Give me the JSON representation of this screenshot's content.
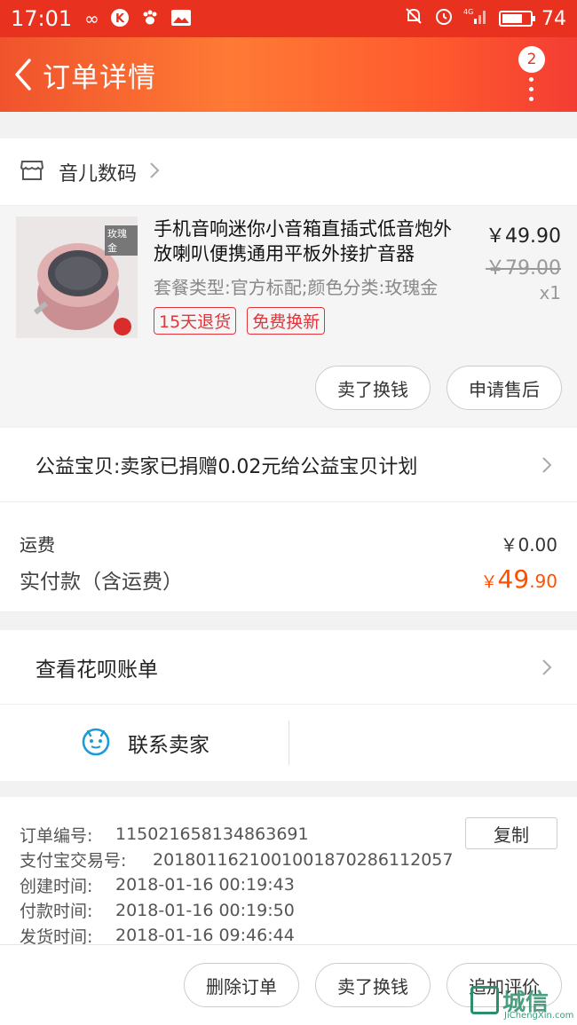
{
  "status_bar": {
    "time": "17:01",
    "network": "4G",
    "battery": "74",
    "battery_level": 0.74
  },
  "nav": {
    "title": "订单详情",
    "badge_count": "2"
  },
  "shop": {
    "name": "音儿数码"
  },
  "product": {
    "title": "手机音响迷你小音箱直插式低音炮外放喇叭便携通用平板外接扩音器",
    "spec": "套餐类型:官方标配;颜色分类:玫瑰金",
    "price": "￥49.90",
    "original_price": "￥79.00",
    "quantity": "x1",
    "thumb_tag": "玫瑰金",
    "badges": [
      "15天退货",
      "免费换新"
    ],
    "actions": [
      "卖了换钱",
      "申请售后"
    ]
  },
  "charity": {
    "text": "公益宝贝:卖家已捐赠0.02元给公益宝贝计划"
  },
  "fees": {
    "shipping_label": "运费",
    "shipping_value": "￥0.00",
    "paid_label": "实付款（含运费）",
    "paid_currency": "￥",
    "paid_int": "49",
    "paid_dec": ".90"
  },
  "huabei": {
    "text": "查看花呗账单"
  },
  "contact": {
    "label": "联系卖家"
  },
  "order_info": {
    "copy_label": "复制",
    "rows": [
      {
        "key": "订单编号:",
        "value": "115021658134863691"
      },
      {
        "key": "支付宝交易号:",
        "value": "2018011621001001870286112057"
      },
      {
        "key": "创建时间:",
        "value": "2018-01-16 00:19:43"
      },
      {
        "key": "付款时间:",
        "value": "2018-01-16 00:19:50"
      },
      {
        "key": "发货时间:",
        "value": "2018-01-16 09:46:44"
      }
    ]
  },
  "bottom_actions": [
    "删除订单",
    "卖了换钱",
    "追加评价"
  ],
  "watermark": {
    "text": "城信",
    "sub": "JiChengXin.com"
  },
  "colors": {
    "accent": "#ff5000",
    "nav_red": "#e8321f",
    "badge_red": "#e4343a"
  }
}
